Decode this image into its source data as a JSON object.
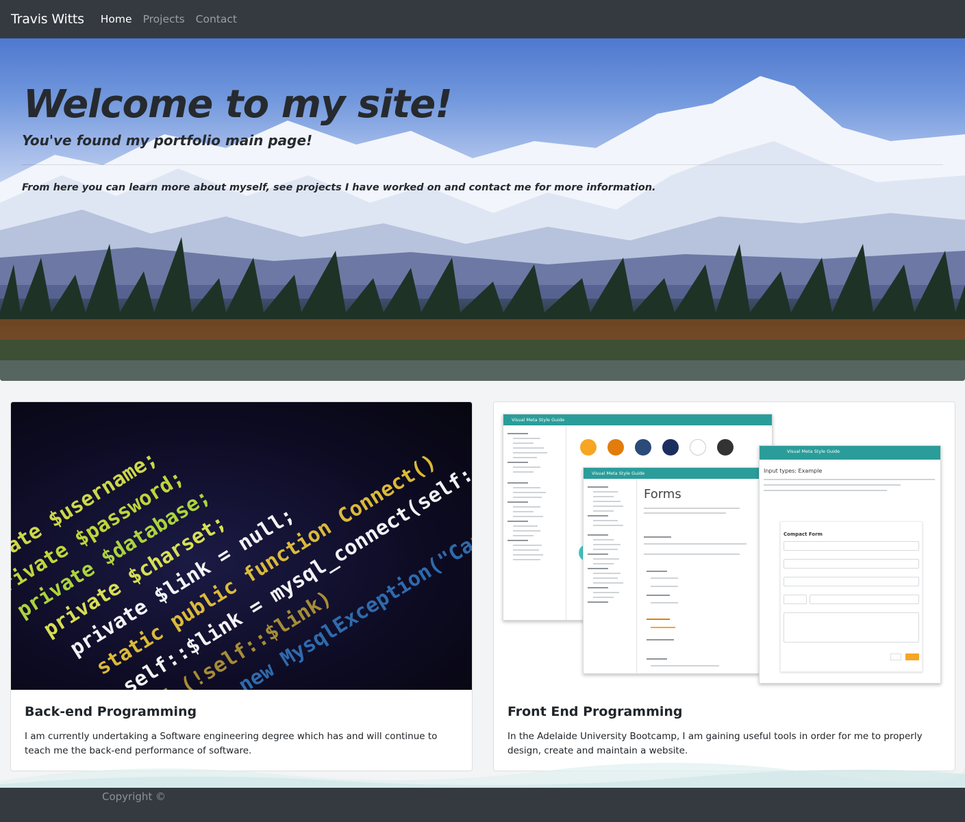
{
  "navbar": {
    "brand": "Travis Witts",
    "links": [
      {
        "label": "Home",
        "active": true
      },
      {
        "label": "Projects",
        "active": false
      },
      {
        "label": "Contact",
        "active": false
      }
    ]
  },
  "hero": {
    "title": "Welcome to my site!",
    "subtitle": "You've found my portfolio main page!",
    "lead": "From here you can learn more about myself, see projects I have worked on and contact me for more information."
  },
  "cards": [
    {
      "title": "Back-end Programming",
      "text": "I am currently undertaking a Software engineering degree which has and will continue to teach me the back-end performance of software."
    },
    {
      "title": "Front End Programming",
      "text": "In the Adelaide University Bootcamp, I am gaining useful tools in order for me to properly design, create and maintain a website."
    }
  ],
  "code_image": {
    "lines": [
      "private $username;",
      "private $password;",
      "private $database;",
      "private $charset;",
      "private $link = null;",
      "static public function Connect()",
      "self::$link = mysql_connect(self::$host,",
      "if (!self::$link)",
      "throw new MysqlException(\"Cannot connect to"
    ]
  },
  "style_guide": {
    "window_title": "Visual Meta Style Guide",
    "forms_heading": "Forms",
    "input_types_heading": "Input types: Example",
    "compact_form": "Compact Form",
    "sections": [
      "Layout",
      "Elements",
      "Components"
    ],
    "swatch_colors": [
      "#f6a623",
      "#e27d0c",
      "#2c4a7a",
      "#1b2f5f",
      "#ffffff",
      "#333333"
    ]
  },
  "footer": {
    "copyright": "Copyright ©"
  }
}
